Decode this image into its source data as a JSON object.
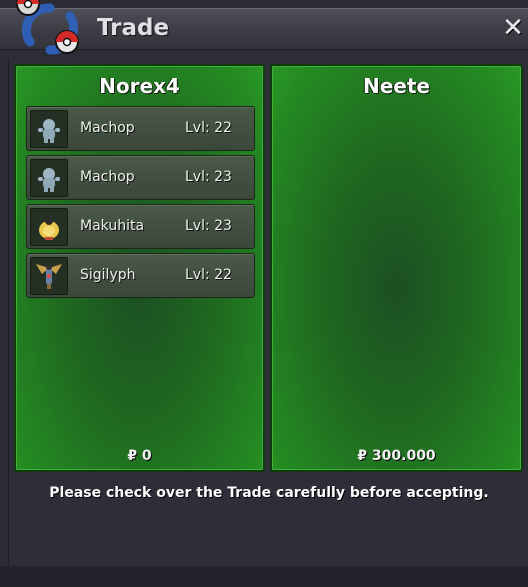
{
  "window": {
    "title": "Trade",
    "close_glyph": "✕"
  },
  "left": {
    "player": "Norex4",
    "money": "₽ 0",
    "pokemon": [
      {
        "name": "Machop",
        "level": "Lvl: 22",
        "icon": "machop-icon"
      },
      {
        "name": "Machop",
        "level": "Lvl: 23",
        "icon": "machop-icon"
      },
      {
        "name": "Makuhita",
        "level": "Lvl: 23",
        "icon": "makuhita-icon"
      },
      {
        "name": "Sigilyph",
        "level": "Lvl: 22",
        "icon": "sigilyph-icon"
      }
    ]
  },
  "right": {
    "player": "Neete",
    "money": "₽ 300.000",
    "pokemon": []
  },
  "notice": "Please check over the Trade carefully before accepting.",
  "colors": {
    "panel_green": "#248a22",
    "border_dark_green": "#0e3b09",
    "window_bg": "#2b2c35"
  }
}
